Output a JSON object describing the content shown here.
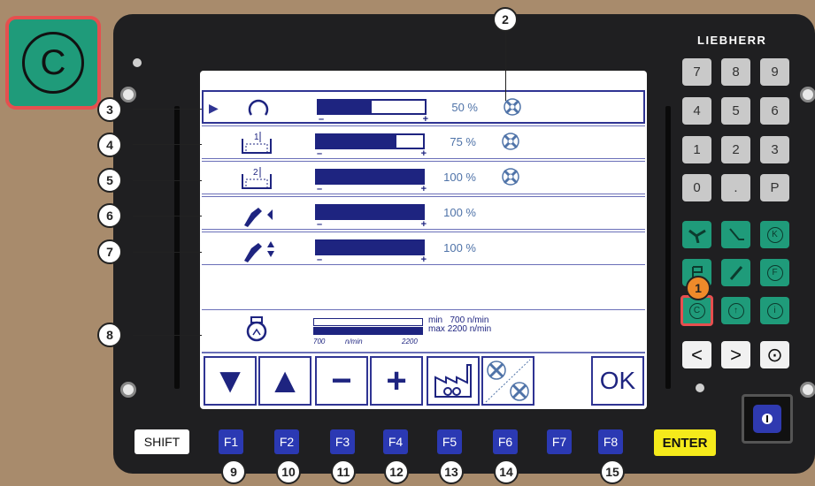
{
  "brand": "LIEBHERR",
  "badge_icon_letter": "C",
  "rows": [
    {
      "icon": "rotate-icon",
      "value_pct": 50,
      "pct_label": "50 %",
      "fan": true,
      "callout": "3"
    },
    {
      "icon": "bin-1-icon",
      "value_pct": 75,
      "pct_label": "75 %",
      "fan": true,
      "callout": "4"
    },
    {
      "icon": "bin-2-icon",
      "value_pct": 100,
      "pct_label": "100 %",
      "fan": true,
      "callout": "5"
    },
    {
      "icon": "spout-horizontal-icon",
      "value_pct": 100,
      "pct_label": "100 %",
      "fan": false,
      "callout": "6"
    },
    {
      "icon": "spout-vertical-icon",
      "value_pct": 100,
      "pct_label": "100 %",
      "fan": false,
      "callout": "7"
    }
  ],
  "speed": {
    "min_label": "min",
    "min_value": "700 n/min",
    "max_label": "max",
    "max_value": "2200 n/min",
    "tick_left": "700",
    "tick_mid": "n/min",
    "tick_right": "2200",
    "callout": "8"
  },
  "fan_callout": "2",
  "softkeys": [
    "▼",
    "▲",
    "−",
    "+",
    "factory-icon",
    "fan-off-icon",
    "",
    "OK"
  ],
  "softkey_ok": "OK",
  "keypad": [
    [
      "7",
      "8",
      "9"
    ],
    [
      "4",
      "5",
      "6"
    ],
    [
      "1",
      "2",
      "3"
    ],
    [
      "0",
      ".",
      "P"
    ]
  ],
  "green_keys_row1": [
    "K"
  ],
  "green_keys_row2": [
    "F"
  ],
  "green_keys_row3": [
    "C",
    "↑",
    "i"
  ],
  "c_key_callout": "1",
  "nav_keys": [
    "<",
    ">",
    "⊙"
  ],
  "function_keys": [
    "F1",
    "F2",
    "F3",
    "F4",
    "F5",
    "F6",
    "F7",
    "F8"
  ],
  "shift_label": "SHIFT",
  "enter_label": "ENTER",
  "fkey_callouts": [
    "9",
    "10",
    "11",
    "12",
    "13",
    "14",
    "15"
  ]
}
